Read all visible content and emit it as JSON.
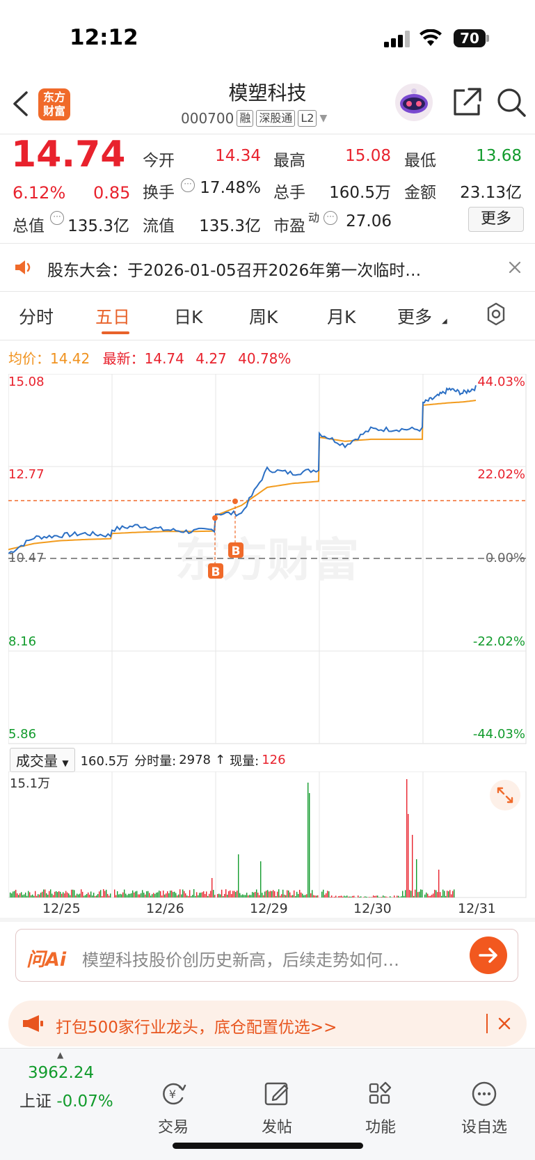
{
  "status_bar": {
    "time": "12:12",
    "battery": "70"
  },
  "header": {
    "logo_line1": "东方",
    "logo_line2": "财富",
    "stock_name": "模塑科技",
    "code": "000700",
    "tags": [
      "融",
      "深股通",
      "L2"
    ]
  },
  "quote": {
    "price": "14.74",
    "change_pct": "6.12%",
    "change_amt": "0.85",
    "open_label": "今开",
    "open": "14.34",
    "high_label": "最高",
    "high": "15.08",
    "low_label": "最低",
    "low": "13.68",
    "turnover_label": "换手",
    "turnover": "17.48%",
    "volume_label": "总手",
    "volume": "160.5万",
    "amount_label": "金额",
    "amount": "23.13亿",
    "mktcap_label": "总值",
    "mktcap": "135.3亿",
    "float_label": "流值",
    "float_cap": "135.3亿",
    "pe_label": "市盈",
    "pe_sup": "动",
    "pe": "27.06",
    "more_label": "更多"
  },
  "notice": {
    "text": "股东大会：于2026-01-05召开2026年第一次临时…"
  },
  "tabs": [
    "分时",
    "五日",
    "日K",
    "周K",
    "月K",
    "更多"
  ],
  "active_tab": "五日",
  "chart_info": {
    "avg_label": "均价：",
    "avg": "14.42",
    "latest_label": "最新：",
    "latest": "14.74",
    "change": "4.27",
    "change_pct": "40.78%"
  },
  "chart_data": {
    "type": "line",
    "x": [
      "12/25",
      "12/26",
      "12/29",
      "12/30",
      "12/31"
    ],
    "series": [
      {
        "values": [
          11.05,
          11.2,
          11.6,
          12.95,
          14.74
        ],
        "color": "#2b6fc4"
      },
      {
        "values": [
          10.95,
          11.15,
          11.5,
          12.6,
          14.42
        ],
        "color": "#f29b1d"
      }
    ],
    "y_ticks_left": [
      "15.08",
      "12.77",
      "10.47",
      "8.16",
      "5.86"
    ],
    "y_ticks_right": [
      "44.03%",
      "22.02%",
      "0.00%",
      "-22.02%",
      "-44.03%"
    ],
    "ylim": [
      5.86,
      15.08
    ],
    "markers": [
      "B",
      "B"
    ],
    "watermark": "东方财富"
  },
  "volume": {
    "selector": "成交量",
    "total": "160.5万",
    "fenshi_label": "分时量:",
    "fenshi": "2978",
    "arrow": "↑",
    "now_label": "现量:",
    "now": "126",
    "max_label": "15.1万"
  },
  "dates": [
    "12/25",
    "12/26",
    "12/29",
    "12/30",
    "12/31"
  ],
  "ai": {
    "logo": "问Ai",
    "prompt": "模塑科技股价创历史新高，后续走势如何…"
  },
  "ad": {
    "text": "打包500家行业龙头，底仓配置优选>>"
  },
  "bottom_nav": {
    "index_value": "3962.24",
    "index_name": "上证",
    "index_change": "-0.07%",
    "items": [
      "交易",
      "发帖",
      "功能",
      "设自选"
    ]
  }
}
